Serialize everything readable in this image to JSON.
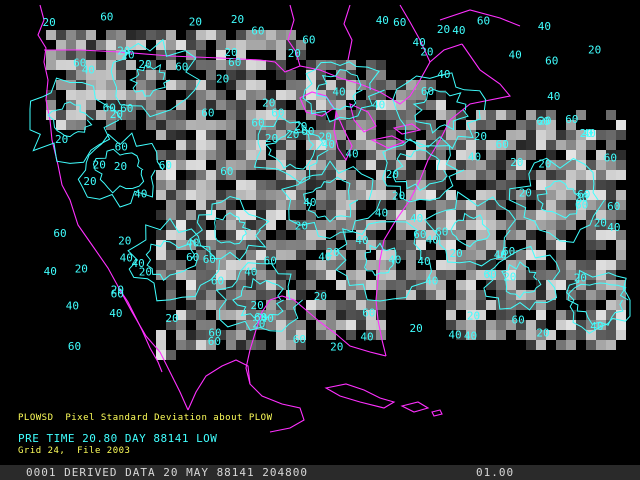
{
  "captions": {
    "product": "PLOWSD  Pixel Standard Deviation about PLOW",
    "time": "PRE TIME 20.80 DAY 88141 LOW",
    "grid": "Grid 24,  File 2003"
  },
  "status_bar": {
    "left": "0001 DERIVED DATA 20 MAY 88141 204800",
    "right": "01.00"
  },
  "contour_levels": [
    "20",
    "40",
    "60"
  ],
  "colors": {
    "background": "#000000",
    "contour": "#40ffff",
    "political_boundaries": "#ff30ff",
    "caption_yellow": "#ffff5a",
    "status_bar": "#2a2a2a"
  }
}
